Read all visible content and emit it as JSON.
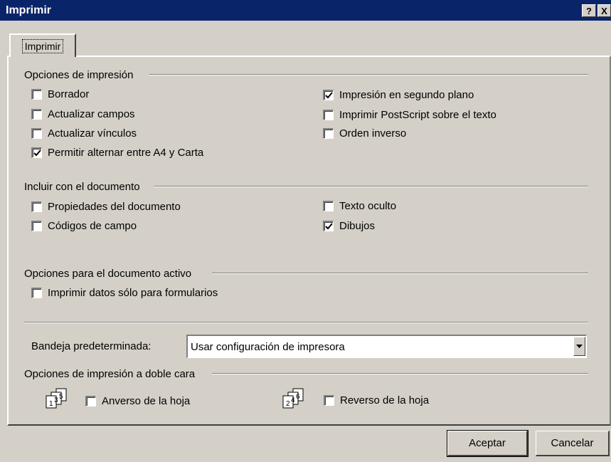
{
  "window": {
    "title": "Imprimir",
    "help_glyph": "?",
    "close_glyph": "X"
  },
  "tabs": [
    {
      "label": "Imprimir",
      "selected": true
    }
  ],
  "print_options": {
    "title": "Opciones de impresión",
    "left": [
      {
        "label": "Borrador",
        "checked": false
      },
      {
        "label": "Actualizar campos",
        "checked": false
      },
      {
        "label": "Actualizar vínculos",
        "checked": false
      },
      {
        "label": "Permitir alternar entre A4 y Carta",
        "checked": true
      }
    ],
    "right": [
      {
        "label": "Impresión en segundo plano",
        "checked": true
      },
      {
        "label": "Imprimir PostScript sobre el texto",
        "checked": false
      },
      {
        "label": "Orden inverso",
        "checked": false
      }
    ]
  },
  "include_document": {
    "title": "Incluir con el documento",
    "left": [
      {
        "label": "Propiedades del documento",
        "checked": false
      },
      {
        "label": "Códigos de campo",
        "checked": false
      }
    ],
    "right": [
      {
        "label": "Texto oculto",
        "checked": false
      },
      {
        "label": "Dibujos",
        "checked": true
      }
    ]
  },
  "active_document": {
    "title": "Opciones para el documento activo",
    "items": [
      {
        "label": "Imprimir datos sólo para formularios",
        "checked": false
      }
    ]
  },
  "tray": {
    "label": "Bandeja predeterminada:",
    "value": "Usar configuración de impresora"
  },
  "duplex": {
    "title": "Opciones de impresión a doble cara",
    "front": {
      "label": "Anverso de la hoja",
      "checked": false,
      "pages": [
        "1",
        "3",
        "5"
      ]
    },
    "back": {
      "label": "Reverso de la hoja",
      "checked": false,
      "pages": [
        "2",
        "4",
        "6"
      ]
    }
  },
  "buttons": {
    "ok": "Aceptar",
    "cancel": "Cancelar"
  }
}
